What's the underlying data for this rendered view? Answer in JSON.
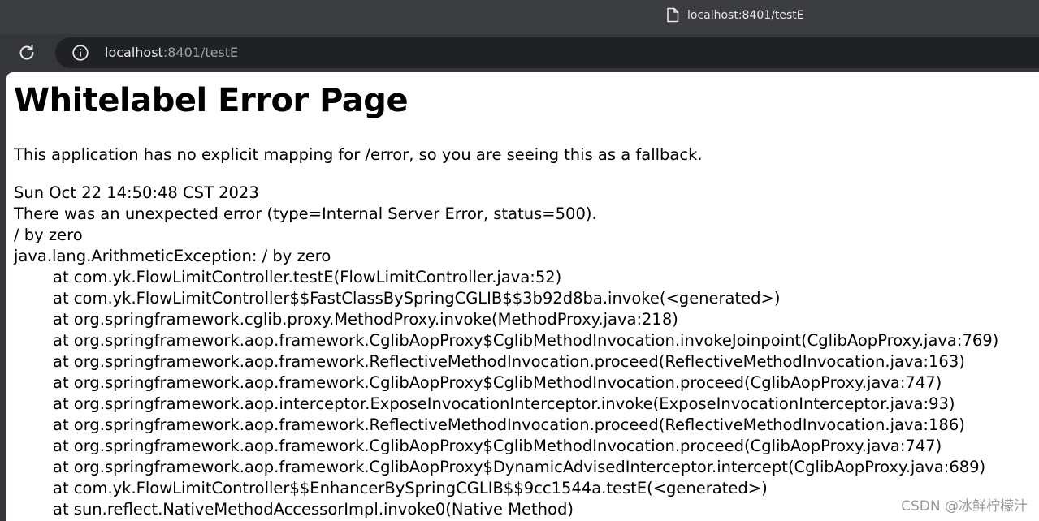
{
  "tab": {
    "title": "localhost:8401/testE"
  },
  "toolbar": {
    "url_host": "localhost",
    "url_path": ":8401/testE"
  },
  "page": {
    "heading": "Whitelabel Error Page",
    "fallback": "This application has no explicit mapping for /error, so you are seeing this as a fallback.",
    "timestamp": "Sun Oct 22 14:50:48 CST 2023",
    "error_summary": "There was an unexpected error (type=Internal Server Error, status=500).",
    "message": "/ by zero",
    "exception": "java.lang.ArithmeticException: / by zero",
    "frames": [
      "at com.yk.FlowLimitController.testE(FlowLimitController.java:52)",
      "at com.yk.FlowLimitController$$FastClassBySpringCGLIB$$3b92d8ba.invoke(<generated>)",
      "at org.springframework.cglib.proxy.MethodProxy.invoke(MethodProxy.java:218)",
      "at org.springframework.aop.framework.CglibAopProxy$CglibMethodInvocation.invokeJoinpoint(CglibAopProxy.java:769)",
      "at org.springframework.aop.framework.ReflectiveMethodInvocation.proceed(ReflectiveMethodInvocation.java:163)",
      "at org.springframework.aop.framework.CglibAopProxy$CglibMethodInvocation.proceed(CglibAopProxy.java:747)",
      "at org.springframework.aop.interceptor.ExposeInvocationInterceptor.invoke(ExposeInvocationInterceptor.java:93)",
      "at org.springframework.aop.framework.ReflectiveMethodInvocation.proceed(ReflectiveMethodInvocation.java:186)",
      "at org.springframework.aop.framework.CglibAopProxy$CglibMethodInvocation.proceed(CglibAopProxy.java:747)",
      "at org.springframework.aop.framework.CglibAopProxy$DynamicAdvisedInterceptor.intercept(CglibAopProxy.java:689)",
      "at com.yk.FlowLimitController$$EnhancerBySpringCGLIB$$9cc1544a.testE(<generated>)",
      "at sun.reflect.NativeMethodAccessorImpl.invoke0(Native Method)"
    ]
  },
  "watermark": "CSDN @冰鲜柠檬汁",
  "icons": {
    "tab": "page-icon",
    "reload": "reload-icon",
    "site_info": "info-icon"
  },
  "colors": {
    "chrome_bg": "#35363a",
    "omnibox_bg": "#202124",
    "url_host": "#e8eaed",
    "url_path": "#9aa0a6",
    "page_bg": "#ffffff"
  }
}
